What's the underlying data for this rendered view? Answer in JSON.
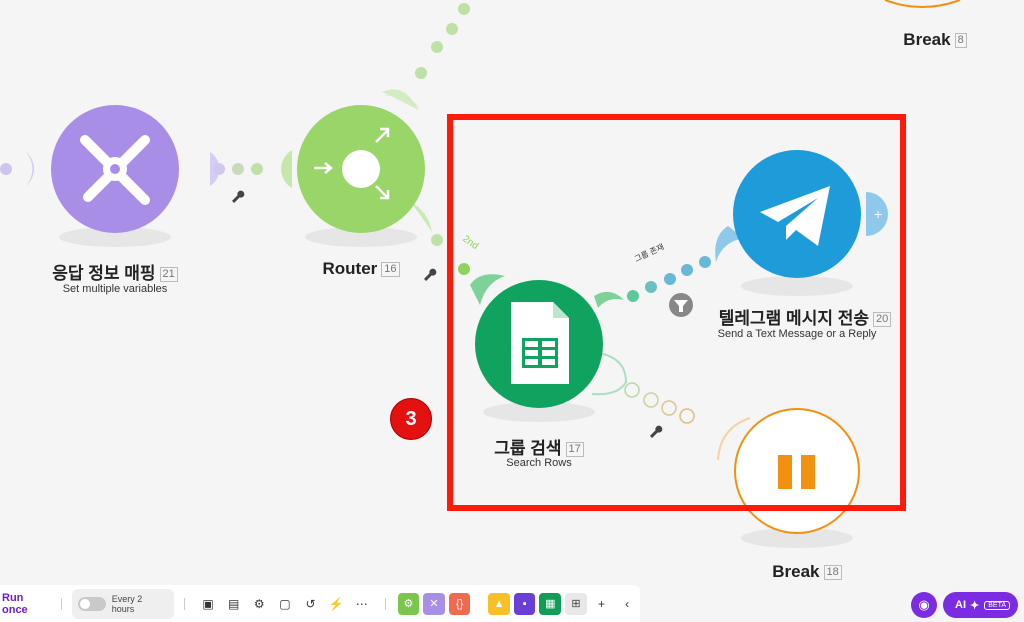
{
  "nodes": {
    "set_vars": {
      "title": "응답 정보 매핑",
      "index": "21",
      "subtitle": "Set multiple variables",
      "color": "#a98ee8"
    },
    "router": {
      "title": "Router",
      "index": "16",
      "color": "#8fd25f"
    },
    "sheets": {
      "title": "그룹 검색",
      "index": "17",
      "subtitle": "Search Rows",
      "color": "#0f9d58"
    },
    "telegram": {
      "title": "텔레그램 메시지 전송",
      "index": "20",
      "subtitle": "Send a Text Message or a Reply",
      "color": "#229ed9"
    },
    "break_top": {
      "title": "Break",
      "index": "8"
    },
    "break_bottom": {
      "title": "Break",
      "index": "18",
      "color": "#f29111"
    }
  },
  "route_labels": {
    "route2": "2nd",
    "filter": "그룹 존재"
  },
  "marker": {
    "number": "3",
    "color": "#ff1a0a"
  },
  "toolbar": {
    "run_once": "Run once",
    "schedule": "Every 2 hours",
    "icons": [
      "save-icon",
      "layout-icon",
      "settings-icon",
      "notes-icon",
      "undo-icon",
      "magic-wand-icon",
      "more-icon"
    ],
    "modules": [
      {
        "name": "tools-module",
        "color": "#7bc74d"
      },
      {
        "name": "flow-control-module",
        "color": "#a98ee8"
      },
      {
        "name": "json-module",
        "color": "#f06a4f"
      },
      {
        "name": "drive-module",
        "color": "#f6c026"
      },
      {
        "name": "docs-module",
        "color": "#6a3fd6"
      },
      {
        "name": "sheets-module",
        "color": "#0f9d58"
      }
    ]
  },
  "ai": {
    "label": "AI",
    "badge": "BETA"
  }
}
